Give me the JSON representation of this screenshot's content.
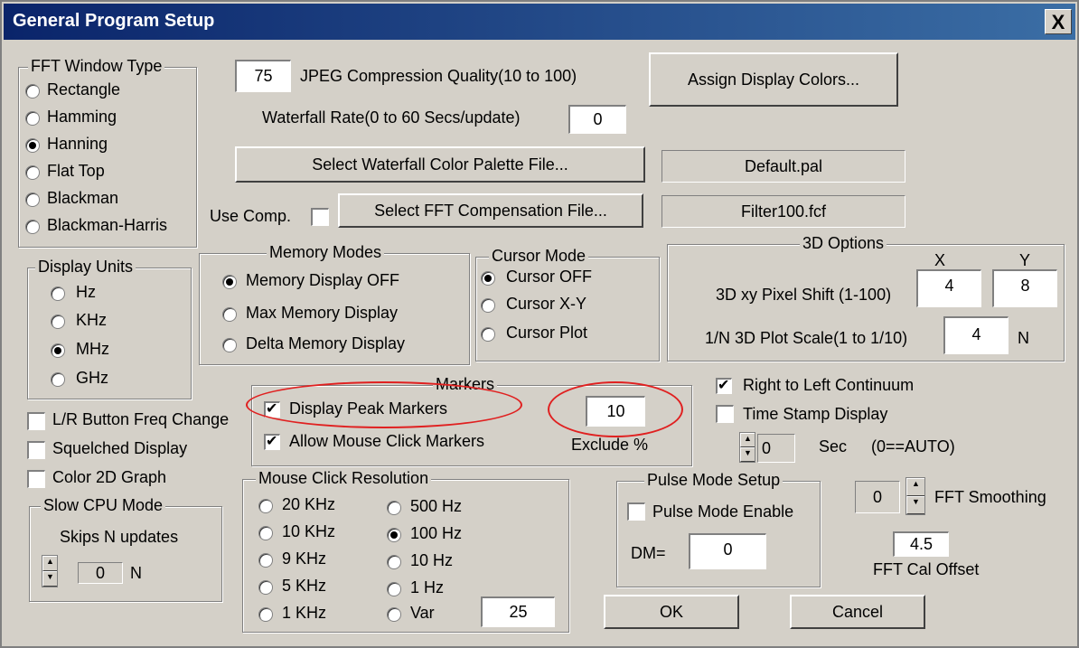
{
  "window": {
    "title": "General Program Setup",
    "close_glyph": "X"
  },
  "fft_window": {
    "title": "FFT Window Type",
    "options": [
      {
        "label": "Rectangle",
        "selected": false
      },
      {
        "label": "Hamming",
        "selected": false
      },
      {
        "label": "Hanning",
        "selected": true
      },
      {
        "label": "Flat Top",
        "selected": false
      },
      {
        "label": "Blackman",
        "selected": false
      },
      {
        "label": "Blackman-Harris",
        "selected": false
      }
    ]
  },
  "jpeg": {
    "value": "75",
    "label": "JPEG Compression Quality(10 to 100)"
  },
  "waterfall_rate": {
    "label": "Waterfall Rate(0 to 60 Secs/update)",
    "value": "0"
  },
  "assign_colors_button": "Assign Display Colors...",
  "palette": {
    "button": "Select Waterfall Color Palette File...",
    "file": "Default.pal"
  },
  "compensation": {
    "use_label": "Use Comp.",
    "button": "Select FFT Compensation File...",
    "file": "Filter100.fcf"
  },
  "display_units": {
    "title": "Display Units",
    "options": [
      {
        "label": "Hz",
        "selected": false
      },
      {
        "label": "KHz",
        "selected": false
      },
      {
        "label": "MHz",
        "selected": true
      },
      {
        "label": "GHz",
        "selected": false
      }
    ]
  },
  "memory_modes": {
    "title": "Memory Modes",
    "options": [
      {
        "label": "Memory Display OFF",
        "selected": true
      },
      {
        "label": "Max Memory Display",
        "selected": false
      },
      {
        "label": "Delta Memory Display",
        "selected": false
      }
    ]
  },
  "cursor_mode": {
    "title": "Cursor Mode",
    "options": [
      {
        "label": "Cursor OFF",
        "selected": true
      },
      {
        "label": "Cursor X-Y",
        "selected": false
      },
      {
        "label": "Cursor Plot",
        "selected": false
      }
    ]
  },
  "options_3d": {
    "title": "3D Options",
    "x_header": "X",
    "y_header": "Y",
    "shift_label": "3D xy Pixel Shift (1-100)",
    "shift_x": "4",
    "shift_y": "8",
    "scale_label": "1/N 3D Plot Scale(1 to 1/10)",
    "scale_value": "4",
    "scale_unit": "N"
  },
  "markers": {
    "title": "Markers",
    "peak_label": "Display Peak Markers",
    "peak_checked": true,
    "mouse_label": "Allow Mouse Click Markers",
    "mouse_checked": true,
    "exclude_value": "10",
    "exclude_label": "Exclude %"
  },
  "right_to_left": {
    "label": "Right to Left Continuum",
    "checked": true
  },
  "time_stamp": {
    "label": "Time Stamp Display",
    "checked": false,
    "sec_value": "0",
    "sec_label": "Sec",
    "auto_note": "(0==AUTO)"
  },
  "checkboxes": {
    "lr_button": {
      "label": "L/R Button Freq Change",
      "checked": false
    },
    "squelched": {
      "label": "Squelched Display",
      "checked": false
    },
    "color2d": {
      "label": "Color 2D Graph",
      "checked": false
    }
  },
  "slow_cpu": {
    "title": "Slow CPU Mode",
    "label": "Skips N updates",
    "value": "0",
    "unit": "N"
  },
  "mouse_resolution": {
    "title": "Mouse Click Resolution",
    "left_options": [
      {
        "label": "20 KHz",
        "selected": false
      },
      {
        "label": "10 KHz",
        "selected": false
      },
      {
        "label": "9 KHz",
        "selected": false
      },
      {
        "label": "5 KHz",
        "selected": false
      },
      {
        "label": "1 KHz",
        "selected": false
      }
    ],
    "right_options": [
      {
        "label": "500 Hz",
        "selected": false
      },
      {
        "label": "100 Hz",
        "selected": true
      },
      {
        "label": "10 Hz",
        "selected": false
      },
      {
        "label": "1 Hz",
        "selected": false
      },
      {
        "label": "Var",
        "selected": false
      }
    ],
    "var_value": "25"
  },
  "pulse_mode": {
    "title": "Pulse Mode Setup",
    "enable_label": "Pulse Mode Enable",
    "enabled": false,
    "dm_label": "DM=",
    "dm_value": "0"
  },
  "fft_smoothing": {
    "value": "0",
    "label": "FFT Smoothing"
  },
  "fft_cal": {
    "value": "4.5",
    "label": "FFT Cal Offset"
  },
  "buttons": {
    "ok": "OK",
    "cancel": "Cancel"
  },
  "colors": {
    "titlebar_start": "#0a246a",
    "titlebar_end": "#3b6ea5",
    "face": "#d4d0c8",
    "highlight_oval": "#e02020"
  }
}
